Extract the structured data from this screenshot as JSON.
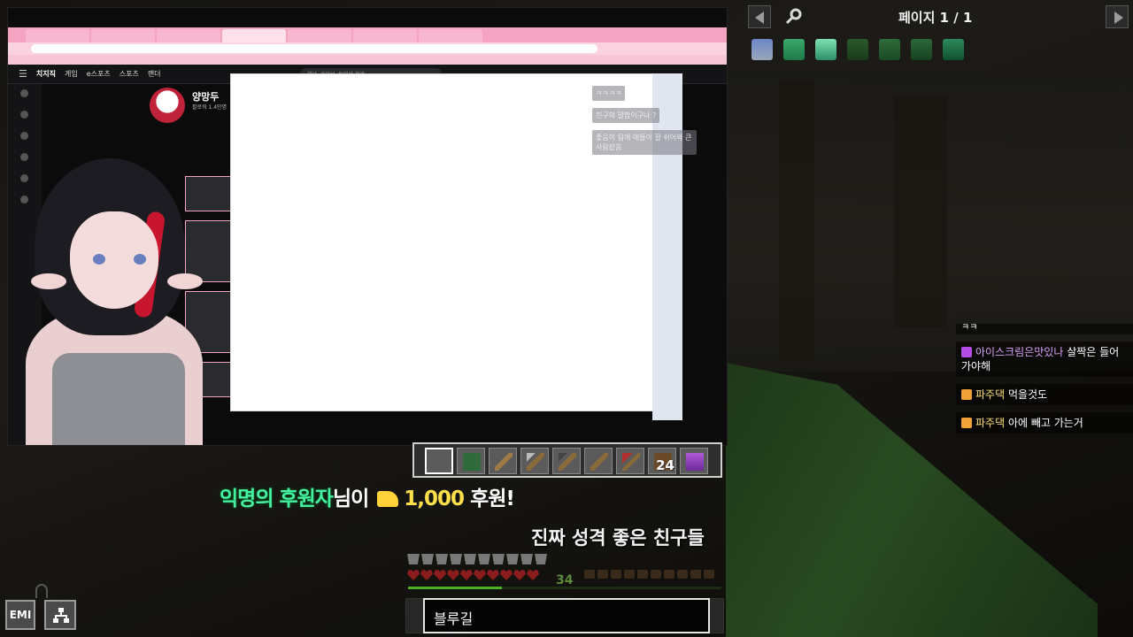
{
  "emi": {
    "page_label": "페이지 1 / 1",
    "button_label": "EMI",
    "items": [
      "water-bucket-icon",
      "emerald-gear-icon",
      "beacon-block-icon",
      "vine-icon",
      "leaf-cluster-icon",
      "moss-block-icon",
      "seagrass-icon"
    ]
  },
  "stream": {
    "channel_name": "양망두",
    "followers": "팔로워 1.4만명",
    "header_nav": [
      "치지직",
      "게임",
      "e스포츠",
      "스포츠",
      "랜더"
    ],
    "search_placeholder": "채널, 라이브, 동영상 검색",
    "mini_chat": [
      "ㅋㅋㅋㅋ",
      "친구의 말밥이구나 ?",
      "좋음이 팀에 애들이 잘 쉬어와 큰 사람같음"
    ]
  },
  "chat": {
    "partial_top": "ㅋㅋ",
    "messages": [
      {
        "name": "아이스크림은맛있나",
        "text": " 살짝은 들어가야해",
        "badge_color": "#b44ce6"
      },
      {
        "name": "파주댁",
        "text": " 먹을것도",
        "badge_color": "#f0a13a"
      },
      {
        "name": "파주댁",
        "text": " 아에 빼고 가는거",
        "badge_color": "#f0a13a"
      }
    ]
  },
  "hotbar": {
    "slots": [
      {
        "item": "empty",
        "count": ""
      },
      {
        "item": "green-block-icon",
        "count": ""
      },
      {
        "item": "stick-icon",
        "count": ""
      },
      {
        "item": "pickaxe-icon",
        "count": ""
      },
      {
        "item": "pickaxe-icon",
        "count": ""
      },
      {
        "item": "stick-icon",
        "count": ""
      },
      {
        "item": "redstone-tool-icon",
        "count": ""
      },
      {
        "item": "wood-block-icon",
        "count": "24"
      },
      {
        "item": "purple-bed-icon",
        "count": ""
      }
    ]
  },
  "donation": {
    "donor": "익명의 후원자",
    "suffix": "님이",
    "amount": "1,000",
    "unit": "후원!",
    "message": "진짜 성격 좋은 친구들"
  },
  "status": {
    "level": "34",
    "xp_fraction": 0.3
  },
  "input": {
    "value": "블루길"
  }
}
